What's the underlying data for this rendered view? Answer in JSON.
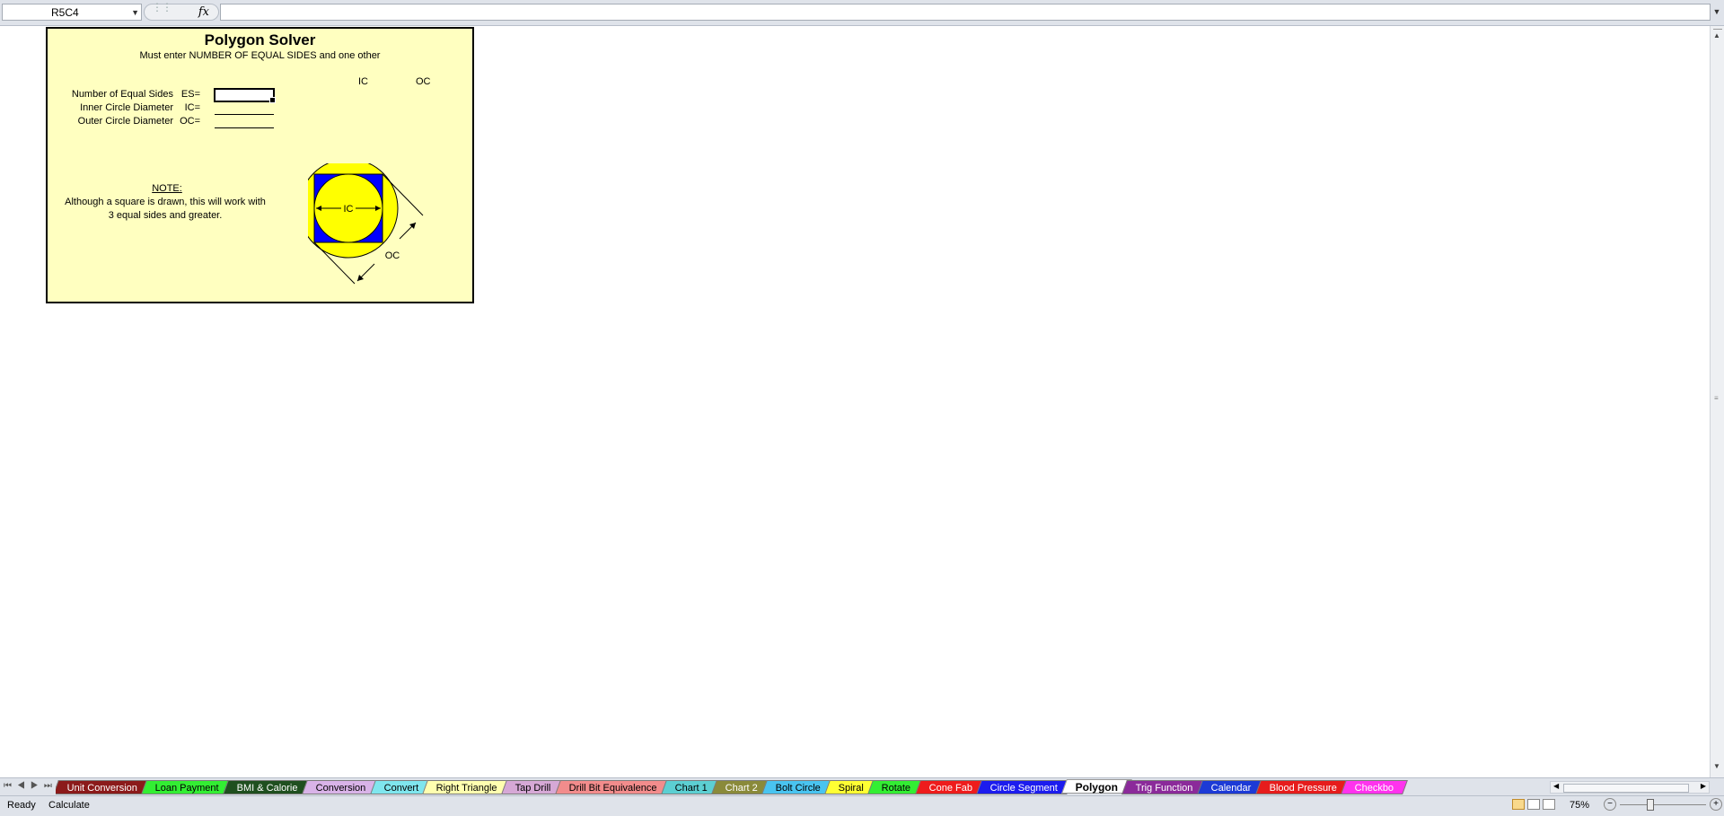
{
  "formula_bar": {
    "name_box": "R5C4",
    "fx_label": "fx",
    "formula_value": ""
  },
  "panel": {
    "title": "Polygon Solver",
    "subtitle": "Must enter NUMBER OF EQUAL SIDES and one other",
    "col_headers": [
      "IC",
      "OC"
    ],
    "rows": [
      {
        "label": "Number of Equal Sides",
        "code": "ES=",
        "value": ""
      },
      {
        "label": "Inner Circle Diameter",
        "code": "IC=",
        "value": ""
      },
      {
        "label": "Outer Circle Diameter",
        "code": "OC=",
        "value": ""
      }
    ],
    "note_title": "NOTE:",
    "note_text": "Although a square is drawn, this will work with 3 equal sides and greater.",
    "diagram": {
      "ic_label": "IC",
      "oc_label": "OC",
      "colors": {
        "circle": "#ffff00",
        "square": "#0000ff"
      }
    }
  },
  "tabs": [
    {
      "label": "Unit Conversion",
      "bg": "#8b1a1a",
      "fg": "#ffffff"
    },
    {
      "label": "Loan Payment",
      "bg": "#33ee33",
      "fg": "#000000"
    },
    {
      "label": "BMI & Calorie",
      "bg": "#1f4f1f",
      "fg": "#ffffff"
    },
    {
      "label": "Conversion",
      "bg": "#d9b3e8",
      "fg": "#000000"
    },
    {
      "label": "Convert",
      "bg": "#7fe6ee",
      "fg": "#000000"
    },
    {
      "label": "Right Triangle",
      "bg": "#ffffb0",
      "fg": "#000000"
    },
    {
      "label": "Tap Drill",
      "bg": "#d6a8d6",
      "fg": "#000000"
    },
    {
      "label": "Drill Bit Equivalence",
      "bg": "#f28c8c",
      "fg": "#000000"
    },
    {
      "label": "Chart 1",
      "bg": "#5ccfd2",
      "fg": "#000000"
    },
    {
      "label": "Chart 2",
      "bg": "#8a8a3a",
      "fg": "#ffffff"
    },
    {
      "label": "Bolt Circle",
      "bg": "#49c4f0",
      "fg": "#000000"
    },
    {
      "label": "Spiral",
      "bg": "#ffff33",
      "fg": "#000000"
    },
    {
      "label": "Rotate",
      "bg": "#33ee33",
      "fg": "#000000"
    },
    {
      "label": "Cone Fab",
      "bg": "#ee1c1c",
      "fg": "#ffffff"
    },
    {
      "label": "Circle Segment",
      "bg": "#1c1cee",
      "fg": "#ffffff"
    },
    {
      "label": "Polygon",
      "bg": "#ffffff",
      "fg": "#000000",
      "active": true
    },
    {
      "label": "Trig Function",
      "bg": "#8b2a9a",
      "fg": "#ffffff"
    },
    {
      "label": "Calendar",
      "bg": "#1c3ad6",
      "fg": "#ffffff"
    },
    {
      "label": "Blood Pressure",
      "bg": "#e61c1c",
      "fg": "#ffffff"
    },
    {
      "label": "Checkbo",
      "bg": "#ff33ee",
      "fg": "#ffffff"
    }
  ],
  "status": {
    "ready": "Ready",
    "calculate": "Calculate",
    "zoom": "75%"
  }
}
